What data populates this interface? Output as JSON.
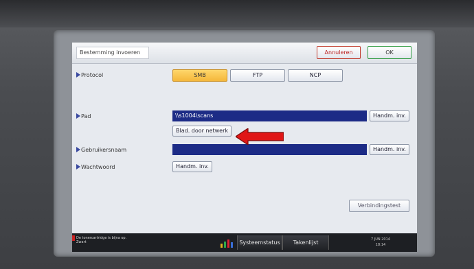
{
  "header": {
    "title": "Bestemming invoeren",
    "cancel_label": "Annuleren",
    "ok_label": "OK"
  },
  "protocol": {
    "label": "Protocol",
    "options": [
      "SMB",
      "FTP",
      "NCP"
    ],
    "selected": "SMB"
  },
  "path": {
    "label": "Pad",
    "value": "\\\\s1004\\scans",
    "handm_label": "Handm. inv.",
    "browse_label": "Blad. door netwerk"
  },
  "username": {
    "label": "Gebruikersnaam",
    "value": "",
    "handm_label": "Handm. inv."
  },
  "password": {
    "label": "Wachtwoord",
    "handm_label": "Handm. inv."
  },
  "connection_test_label": "Verbindingstest",
  "statusbar": {
    "message_line1": "De tonercartridge is bijna op.",
    "message_line2": "Zwart",
    "system_status_label": "Systeemstatus",
    "job_list_label": "Takenlijst",
    "date": "7 JUN  2014",
    "time": "18:14"
  },
  "colors": {
    "accent_selected": "#f4b73a",
    "field_fill": "#1c2b86",
    "cancel_border": "#c0392b",
    "ok_border": "#2d9a3f",
    "annotation_arrow": "#e01616"
  }
}
